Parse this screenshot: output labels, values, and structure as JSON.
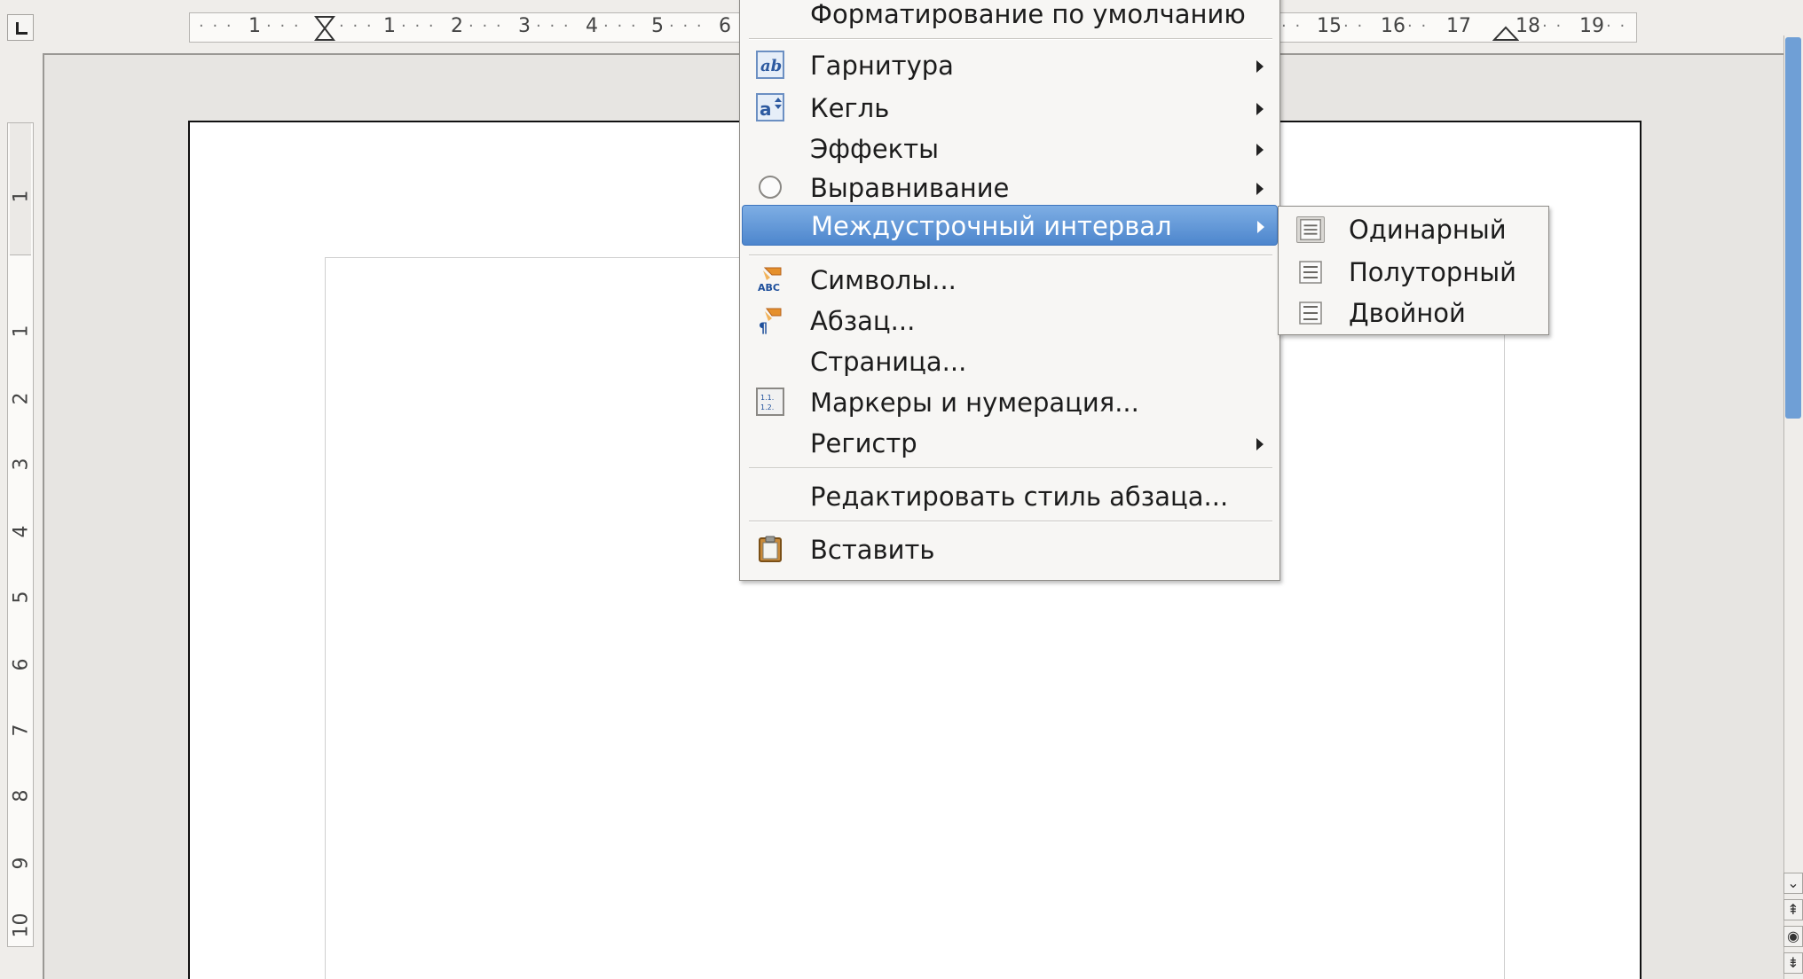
{
  "ruler": {
    "horizontal_numbers": [
      "1",
      "1",
      "2",
      "3",
      "4",
      "5",
      "6",
      "15",
      "16",
      "17",
      "18",
      "19"
    ],
    "vertical_numbers": [
      "1",
      "1",
      "2",
      "3",
      "4",
      "5",
      "6",
      "7",
      "8",
      "9",
      "10"
    ]
  },
  "context_menu": {
    "items": [
      {
        "label": "Форматирование по умолчанию",
        "icon": "none",
        "submenu": false
      },
      {
        "label": "Гарнитура",
        "icon": "font-name-icon",
        "submenu": true
      },
      {
        "label": "Кегль",
        "icon": "font-size-icon",
        "submenu": true
      },
      {
        "label": "Эффекты",
        "icon": "none",
        "submenu": true
      },
      {
        "label": "Выравнивание",
        "icon": "radio-icon",
        "submenu": true
      },
      {
        "label": "Междустрочный интервал",
        "icon": "none",
        "submenu": true,
        "selected": true
      },
      {
        "label": "Символы...",
        "icon": "character-icon",
        "submenu": false
      },
      {
        "label": "Абзац...",
        "icon": "paragraph-icon",
        "submenu": false
      },
      {
        "label": "Страница...",
        "icon": "none",
        "submenu": false
      },
      {
        "label": "Маркеры и нумерация...",
        "icon": "numbering-icon",
        "submenu": false
      },
      {
        "label": "Регистр",
        "icon": "none",
        "submenu": true
      },
      {
        "label": "Редактировать стиль абзаца...",
        "icon": "none",
        "submenu": false
      },
      {
        "label": "Вставить",
        "icon": "paste-icon",
        "submenu": false
      }
    ]
  },
  "submenu": {
    "items": [
      {
        "label": "Одинарный",
        "icon": "line-spacing-icon",
        "checked": true
      },
      {
        "label": "Полуторный",
        "icon": "line-spacing-icon",
        "checked": false
      },
      {
        "label": "Двойной",
        "icon": "line-spacing-icon",
        "checked": false
      }
    ]
  },
  "colors": {
    "selection": "#4d86cd",
    "scrollbar_thumb": "#6f9fd6",
    "menu_bg": "#f7f6f4"
  }
}
